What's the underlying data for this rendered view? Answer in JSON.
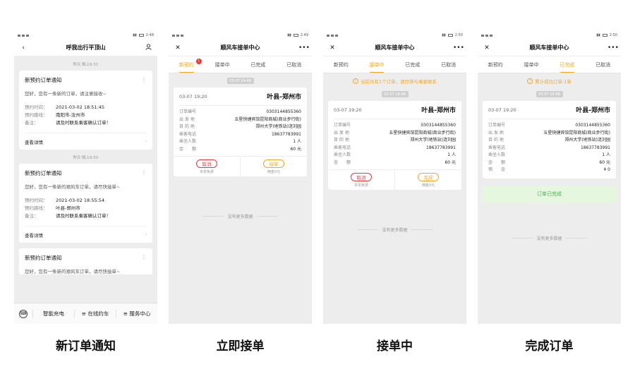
{
  "statusbar": {
    "times": [
      "2:48",
      "2:49",
      "2:50",
      "2:50"
    ]
  },
  "phone1": {
    "title": "呼我出行平顶山",
    "back_icon": "chevron-left-icon",
    "user_icon": "user-icon",
    "messages": [
      {
        "time": "昨天 晚上6:51",
        "title": "新预约订单通知",
        "text": "您好，您有一条新的订单，请注意接收~",
        "rows": [
          {
            "k": "预约时间：",
            "v": "2021-03-02 18:51:45"
          },
          {
            "k": "预约路线：",
            "v": "南阳市-汝州市"
          },
          {
            "k": "备注：",
            "v": "请及时联系乘客确认订单！"
          }
        ],
        "detail": "查看详情"
      },
      {
        "time": "昨天 晚上6:55",
        "title": "新预约订单通知",
        "text": "您好，您有一条新的顺风车订单，请尽快接单~",
        "rows": [
          {
            "k": "预约时间：",
            "v": "2021-03-02 18:55:54"
          },
          {
            "k": "预约路线：",
            "v": "叶县-郑州市"
          },
          {
            "k": "备注：",
            "v": "请及时联系乘客确认订单！"
          }
        ],
        "detail": "查看详情"
      },
      {
        "title": "新预约订单通知",
        "text": "您好，您有一条新的顺风车订单，请尽快接单~"
      }
    ],
    "bottom_menu": [
      "智能充电",
      "≡ 在线约车",
      "≡ 服务中心"
    ]
  },
  "center_title": "顺风车接单中心",
  "tabs": [
    "新预约",
    "接单中",
    "已完成",
    "已取消"
  ],
  "tab_badge": "1",
  "order": {
    "time_pill": "03-07 14:48",
    "date": "03-07 19:20",
    "route": "叶县-郑州市",
    "rows": [
      {
        "k": "订单编号",
        "v": "0303144855360"
      },
      {
        "k": "出 发 地",
        "v": "五星快捷宾馆昆阳商城(商业步行街)"
      },
      {
        "k": "目 的 地",
        "v": "郑州大学(地铁站)涟刘园"
      },
      {
        "k": "乘客电话",
        "v": "18637783991"
      },
      {
        "k": "乘坐人数",
        "v": "1 人"
      },
      {
        "k": "金　　额",
        "v": "60 元"
      }
    ],
    "commission_row": {
      "k": "佣　　金",
      "v": "¥ 0"
    }
  },
  "phone2": {
    "cancel": "取消",
    "cancel_sub": "本单免费",
    "accept": "接单",
    "accept_sub": "佣金0元"
  },
  "phone3": {
    "notice": "当前共有1个订单，请尽快与乘客联系",
    "cancel": "取消",
    "cancel_sub": "本单免费",
    "finish": "完成",
    "finish_sub": "佣金0元"
  },
  "phone4": {
    "notice": "累计成功订单:1单",
    "done": "订单已完成"
  },
  "no_more": "没有更多数据",
  "captions": [
    "新订单通知",
    "立即接单",
    "接单中",
    "完成订单"
  ],
  "colors": {
    "accent": "#f5a623",
    "danger": "#e53935",
    "success": "#4caf50"
  }
}
